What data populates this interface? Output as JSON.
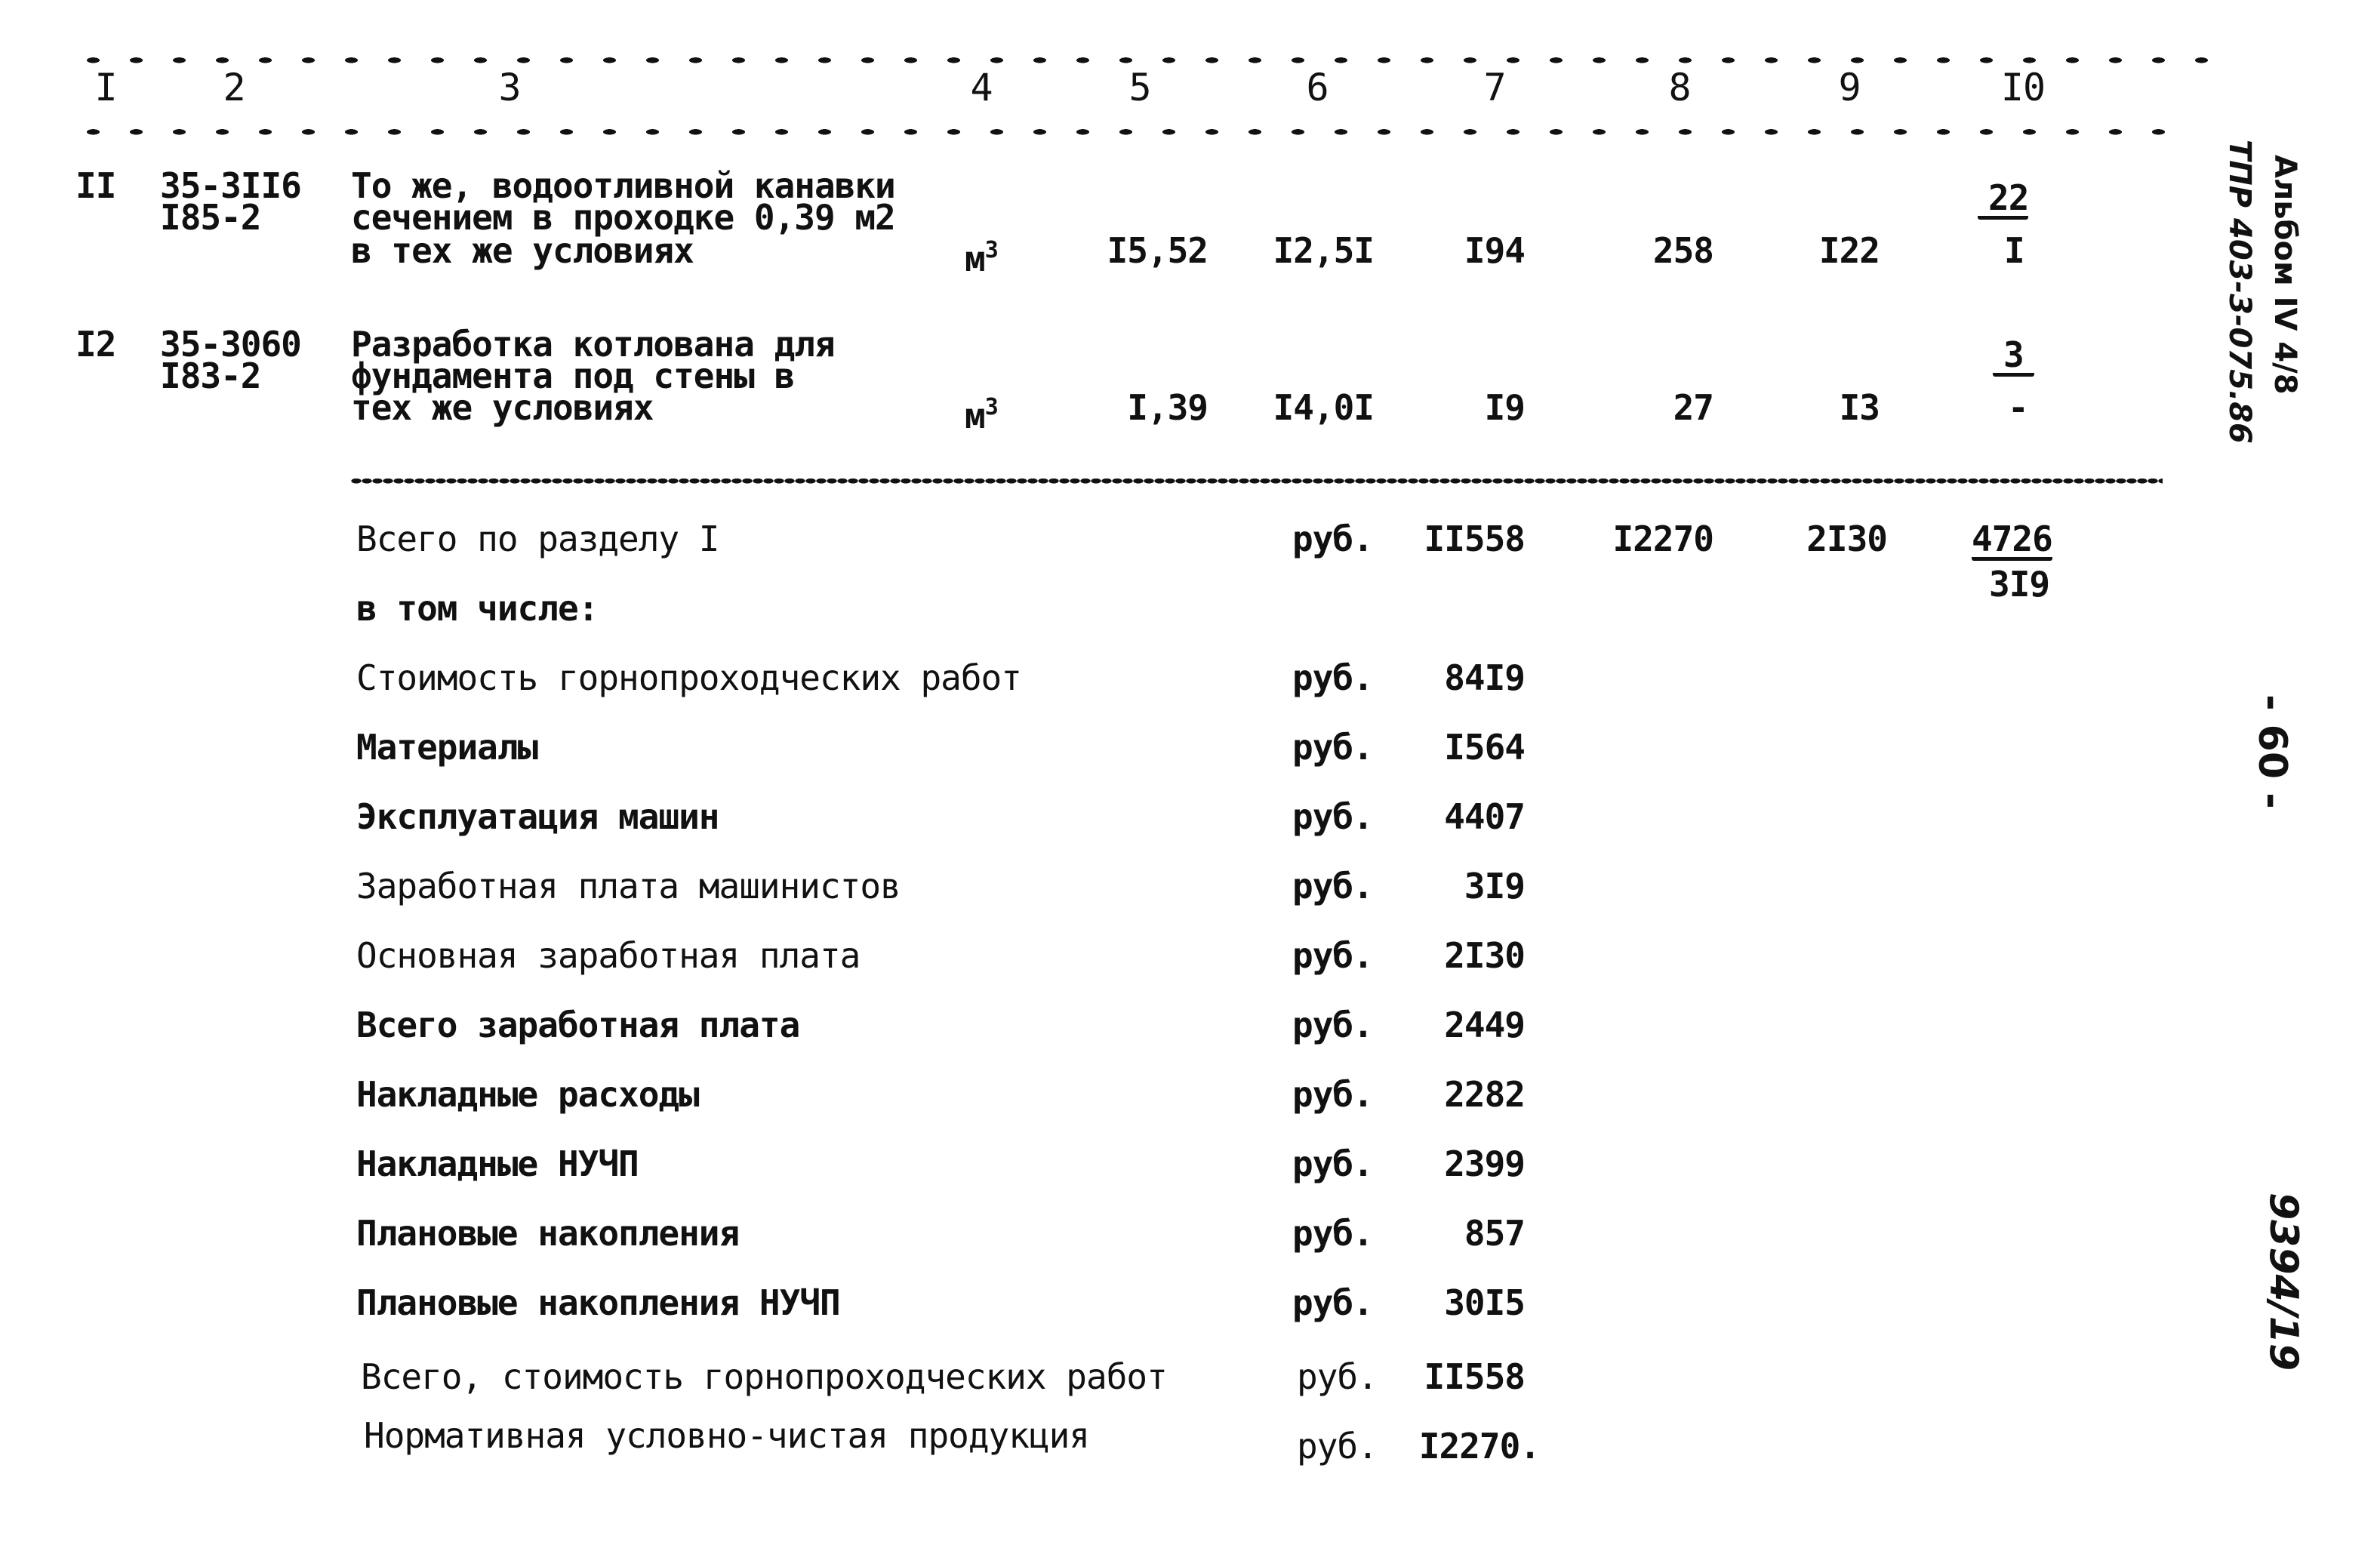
{
  "header": {
    "columns": [
      "I",
      "2",
      "3",
      "4",
      "5",
      "6",
      "7",
      "8",
      "9",
      "I0"
    ]
  },
  "rows": [
    {
      "num": "II",
      "code": [
        "35-3II6",
        "I85-2"
      ],
      "description": [
        "То же, водоотливной канавки",
        "сечением в проходке 0,39 м2",
        "в тех же условиях"
      ],
      "unit": "м",
      "unit_sup": "3",
      "col5": "I5,52",
      "col6": "I2,5I",
      "col7": "I94",
      "col8": "258",
      "col9": "I22",
      "col10_top": "22",
      "col10_bottom": "I"
    },
    {
      "num": "I2",
      "code": [
        "35-3060",
        "I83-2"
      ],
      "description": [
        "Разработка котлована для",
        "фундамента под стены в",
        "тех же условиях"
      ],
      "unit": "м",
      "unit_sup": "3",
      "col5": "I,39",
      "col6": "I4,0I",
      "col7": "I9",
      "col8": "27",
      "col9": "I3",
      "col10_top": "3",
      "col10_bottom": "-"
    }
  ],
  "section_total": {
    "label": "Всего по разделу I",
    "unit": "руб.",
    "col7": "II558",
    "col8": "I2270",
    "col9": "2I30",
    "col10_top": "4726",
    "col10_bottom": "3I9"
  },
  "including_label": "в том числе:",
  "breakdown": [
    {
      "label": "Стоимость горнопроходческих работ",
      "unit": "руб.",
      "value": "84I9"
    },
    {
      "label": "Материалы",
      "unit": "руб.",
      "value": "I564"
    },
    {
      "label": "Эксплуатация машин",
      "unit": "руб.",
      "value": "4407"
    },
    {
      "label": "Заработная плата машинистов",
      "unit": "руб.",
      "value": "3I9"
    },
    {
      "label": "Основная заработная плата",
      "unit": "руб.",
      "value": "2I30"
    },
    {
      "label": "Всего заработная плата",
      "unit": "руб.",
      "value": "2449"
    },
    {
      "label": "Накладные расходы",
      "unit": "руб.",
      "value": "2282"
    },
    {
      "label": "Накладные НУЧП",
      "unit": "руб.",
      "value": "2399"
    },
    {
      "label": "Плановые накопления",
      "unit": "руб.",
      "value": "857"
    },
    {
      "label": "Плановые накопления НУЧП",
      "unit": "руб.",
      "value": "30I5"
    },
    {
      "label": "Всего, стоимость горнопроходческих работ",
      "unit": "руб.",
      "value": "II558"
    },
    {
      "label": "Нормативная условно-чистая продукция",
      "unit": "руб.",
      "value": "I2270."
    }
  ],
  "margin": {
    "album": "Альбом IV 4/8",
    "project": "ТПР 403-3-075.86",
    "page_number": "- 60 -",
    "archive_number": "9394/19"
  }
}
